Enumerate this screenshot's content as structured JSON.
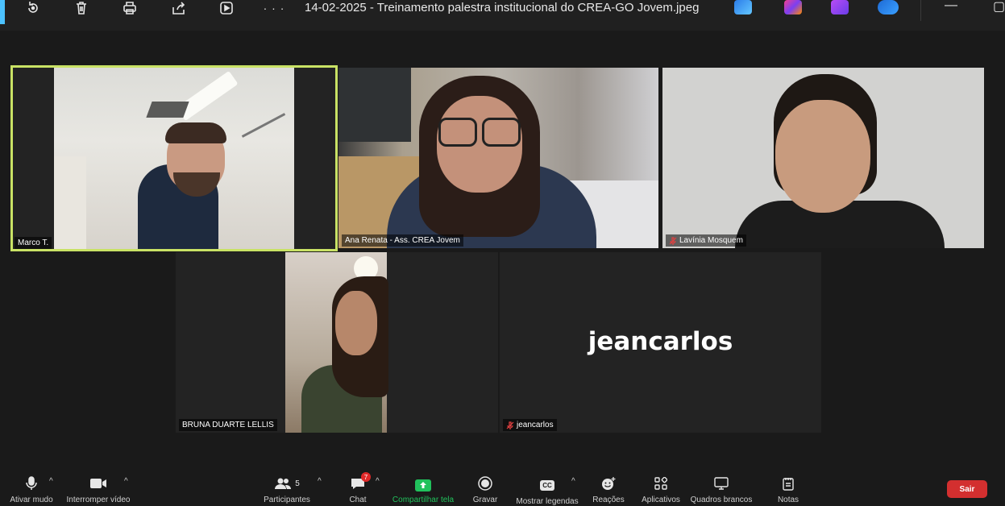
{
  "window": {
    "title": "14-02-2025 - Treinamento palestra institucional do CREA-GO Jovem.jpeg",
    "more_label": "· · ·"
  },
  "participants": [
    {
      "name": "Marco T.",
      "video": true,
      "muted": false,
      "speaking": true
    },
    {
      "name": "Ana Renata - Ass. CREA Jovem",
      "video": true,
      "muted": false
    },
    {
      "name": "Lavínia Mosquem",
      "video": true,
      "muted": true
    },
    {
      "name": "BRUNA DUARTE LELLIS",
      "video": true,
      "muted": false
    },
    {
      "name": "jeancarlos",
      "video": false,
      "muted": true,
      "display_name": "jeancarlos"
    }
  ],
  "toolbar": {
    "mute_label": "Ativar mudo",
    "video_label": "Interromper vídeo",
    "participants_label": "Participantes",
    "participants_count": "5",
    "chat_label": "Chat",
    "chat_badge": "7",
    "share_label": "Compartilhar tela",
    "record_label": "Gravar",
    "captions_label": "Mostrar legendas",
    "captions_icon_text": "CC",
    "reactions_label": "Reações",
    "apps_label": "Aplicativos",
    "whiteboards_label": "Quadros brancos",
    "notes_label": "Notas",
    "leave_label": "Sair"
  },
  "colors": {
    "active_speaker_border": "#c9e265",
    "share_green": "#21c15c",
    "leave_red": "#d32f2f",
    "muted_red": "#e04040"
  }
}
